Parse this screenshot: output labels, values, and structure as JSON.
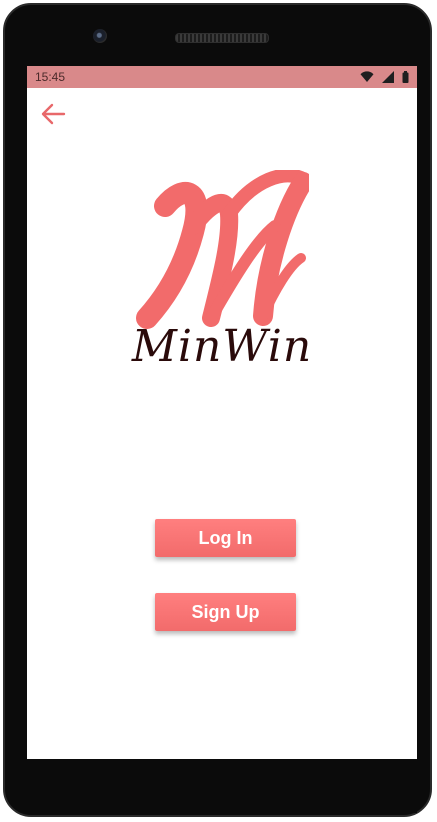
{
  "status_bar": {
    "time": "15:45",
    "icons": [
      "wifi-icon",
      "signal-icon",
      "battery-icon"
    ],
    "background": "#d9898a"
  },
  "header": {
    "back_icon": "arrow-left-icon",
    "accent": "#f26b6b"
  },
  "logo": {
    "mark": "M",
    "wordmark": "MinWin",
    "mark_color": "#f26b6b",
    "wordmark_color": "#2a0a0a"
  },
  "actions": {
    "login_label": "Log In",
    "signup_label": "Sign Up",
    "button_color": "#f87676"
  }
}
